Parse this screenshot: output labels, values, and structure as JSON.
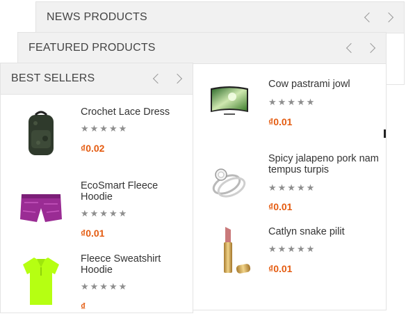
{
  "panels": {
    "news": {
      "title": "NEWS PRODUCTS"
    },
    "featured": {
      "title": "FEATURED PRODUCTS"
    },
    "best": {
      "title": "BEST SELLERS"
    }
  },
  "rating_stars": "★★★★★",
  "best_sellers": [
    {
      "name": "Crochet Lace Dress",
      "currency": "₫",
      "price": "0.02",
      "image": "backpack-image"
    },
    {
      "name": "EcoSmart Fleece Hoodie",
      "currency": "₫",
      "price": "0.01",
      "image": "shorts-image"
    },
    {
      "name": "Fleece Sweatshirt Hoodie",
      "currency": "₫",
      "price": "",
      "image": "polo-shirt-image"
    }
  ],
  "featured": [
    {
      "name": "Cow pastrami jowl",
      "currency": "₫",
      "price": "0.01",
      "image": "curved-tv-image"
    },
    {
      "name": "Spicy jalapeno pork nam tempus turpis",
      "currency": "₫",
      "price": "0.01",
      "image": "diamond-ring-image"
    },
    {
      "name": "Catlyn snake pilit",
      "currency": "₫",
      "price": "0.01",
      "image": "lipstick-image"
    }
  ],
  "colors": {
    "price": "#e45b10",
    "header_bg": "#f1f1f1",
    "stars": "#8e8e8e"
  }
}
